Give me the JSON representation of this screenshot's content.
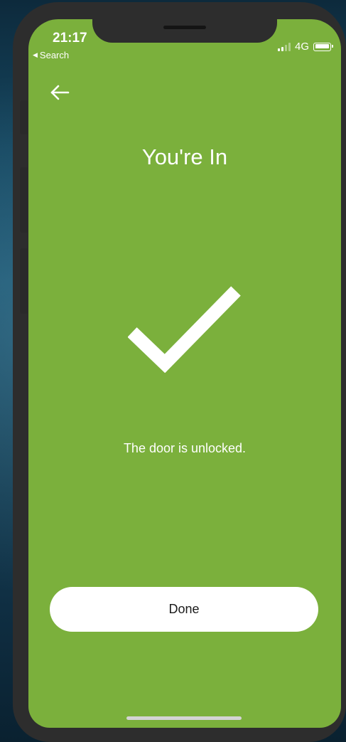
{
  "status_bar": {
    "time": "21:17",
    "back_app_label": "Search",
    "network": "4G",
    "signal_bars_active": 2,
    "signal_bars_total": 4,
    "battery_level": 0.9
  },
  "header": {
    "back_icon": "arrow-left-icon"
  },
  "main": {
    "title": "You're In",
    "status_icon": "checkmark-icon",
    "message": "The door is unlocked."
  },
  "actions": {
    "done_label": "Done"
  },
  "colors": {
    "screen_background": "#7bb03c",
    "text": "#ffffff",
    "button_background": "#ffffff",
    "button_text": "#1a1a1a",
    "phone_frame": "#2d2d2d"
  }
}
